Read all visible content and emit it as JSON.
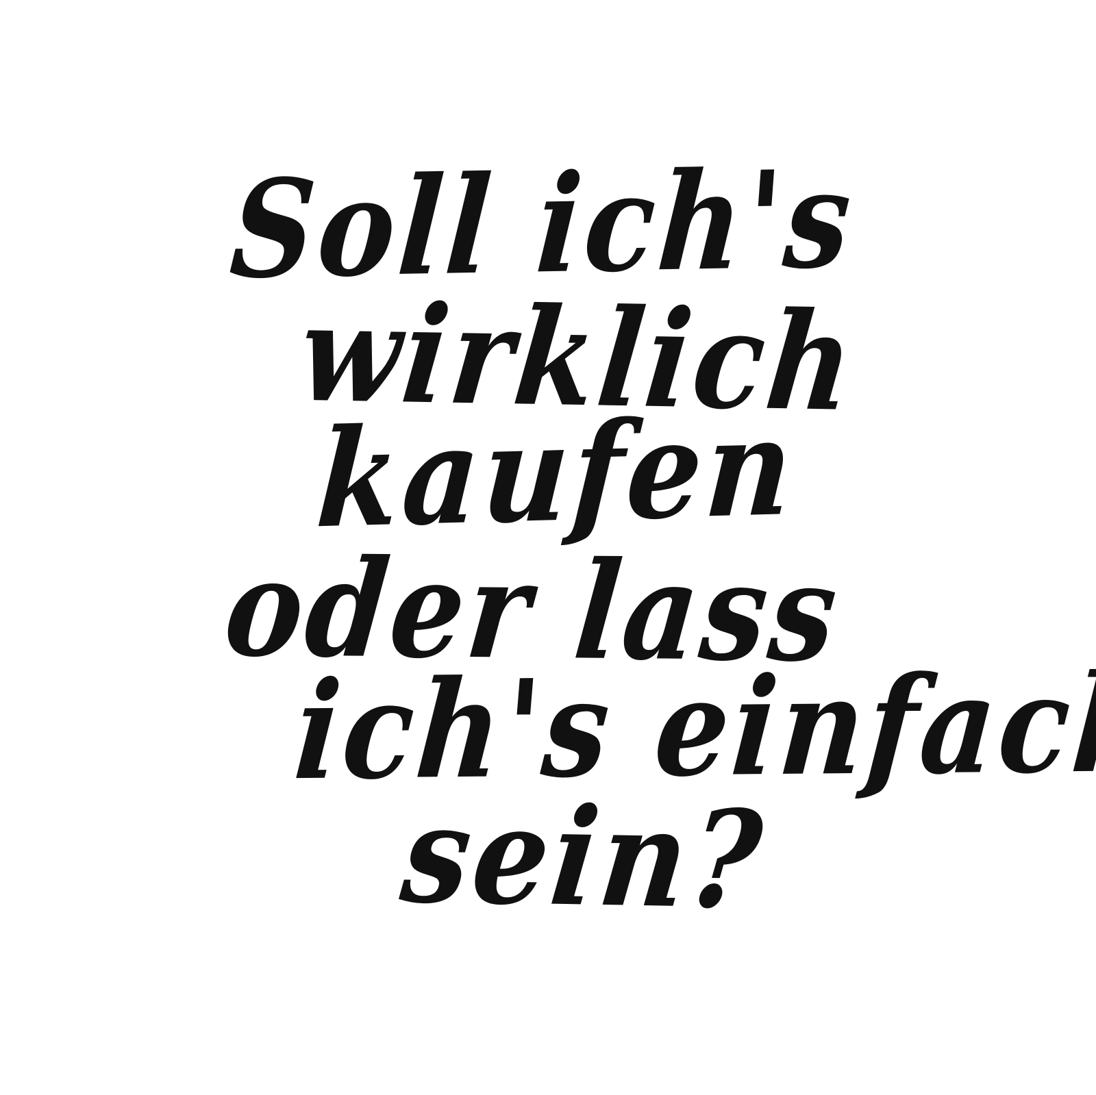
{
  "quote": {
    "lines": [
      "Soll ich's",
      "wirklich",
      "kaufen",
      "oder lass",
      "ich's einfach",
      "sein?"
    ],
    "ink_color": "#111111",
    "background_color": "#ffffff"
  }
}
